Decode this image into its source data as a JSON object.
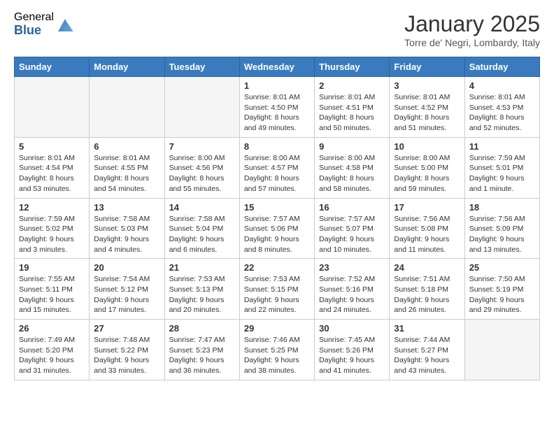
{
  "header": {
    "logo_general": "General",
    "logo_blue": "Blue",
    "month_title": "January 2025",
    "location": "Torre de' Negri, Lombardy, Italy"
  },
  "days_of_week": [
    "Sunday",
    "Monday",
    "Tuesday",
    "Wednesday",
    "Thursday",
    "Friday",
    "Saturday"
  ],
  "weeks": [
    [
      {
        "day": "",
        "sunrise": "",
        "sunset": "",
        "daylight": "",
        "empty": true
      },
      {
        "day": "",
        "sunrise": "",
        "sunset": "",
        "daylight": "",
        "empty": true
      },
      {
        "day": "",
        "sunrise": "",
        "sunset": "",
        "daylight": "",
        "empty": true
      },
      {
        "day": "1",
        "sunrise": "Sunrise: 8:01 AM",
        "sunset": "Sunset: 4:50 PM",
        "daylight": "Daylight: 8 hours and 49 minutes.",
        "empty": false
      },
      {
        "day": "2",
        "sunrise": "Sunrise: 8:01 AM",
        "sunset": "Sunset: 4:51 PM",
        "daylight": "Daylight: 8 hours and 50 minutes.",
        "empty": false
      },
      {
        "day": "3",
        "sunrise": "Sunrise: 8:01 AM",
        "sunset": "Sunset: 4:52 PM",
        "daylight": "Daylight: 8 hours and 51 minutes.",
        "empty": false
      },
      {
        "day": "4",
        "sunrise": "Sunrise: 8:01 AM",
        "sunset": "Sunset: 4:53 PM",
        "daylight": "Daylight: 8 hours and 52 minutes.",
        "empty": false
      }
    ],
    [
      {
        "day": "5",
        "sunrise": "Sunrise: 8:01 AM",
        "sunset": "Sunset: 4:54 PM",
        "daylight": "Daylight: 8 hours and 53 minutes.",
        "empty": false
      },
      {
        "day": "6",
        "sunrise": "Sunrise: 8:01 AM",
        "sunset": "Sunset: 4:55 PM",
        "daylight": "Daylight: 8 hours and 54 minutes.",
        "empty": false
      },
      {
        "day": "7",
        "sunrise": "Sunrise: 8:00 AM",
        "sunset": "Sunset: 4:56 PM",
        "daylight": "Daylight: 8 hours and 55 minutes.",
        "empty": false
      },
      {
        "day": "8",
        "sunrise": "Sunrise: 8:00 AM",
        "sunset": "Sunset: 4:57 PM",
        "daylight": "Daylight: 8 hours and 57 minutes.",
        "empty": false
      },
      {
        "day": "9",
        "sunrise": "Sunrise: 8:00 AM",
        "sunset": "Sunset: 4:58 PM",
        "daylight": "Daylight: 8 hours and 58 minutes.",
        "empty": false
      },
      {
        "day": "10",
        "sunrise": "Sunrise: 8:00 AM",
        "sunset": "Sunset: 5:00 PM",
        "daylight": "Daylight: 8 hours and 59 minutes.",
        "empty": false
      },
      {
        "day": "11",
        "sunrise": "Sunrise: 7:59 AM",
        "sunset": "Sunset: 5:01 PM",
        "daylight": "Daylight: 9 hours and 1 minute.",
        "empty": false
      }
    ],
    [
      {
        "day": "12",
        "sunrise": "Sunrise: 7:59 AM",
        "sunset": "Sunset: 5:02 PM",
        "daylight": "Daylight: 9 hours and 3 minutes.",
        "empty": false
      },
      {
        "day": "13",
        "sunrise": "Sunrise: 7:58 AM",
        "sunset": "Sunset: 5:03 PM",
        "daylight": "Daylight: 9 hours and 4 minutes.",
        "empty": false
      },
      {
        "day": "14",
        "sunrise": "Sunrise: 7:58 AM",
        "sunset": "Sunset: 5:04 PM",
        "daylight": "Daylight: 9 hours and 6 minutes.",
        "empty": false
      },
      {
        "day": "15",
        "sunrise": "Sunrise: 7:57 AM",
        "sunset": "Sunset: 5:06 PM",
        "daylight": "Daylight: 9 hours and 8 minutes.",
        "empty": false
      },
      {
        "day": "16",
        "sunrise": "Sunrise: 7:57 AM",
        "sunset": "Sunset: 5:07 PM",
        "daylight": "Daylight: 9 hours and 10 minutes.",
        "empty": false
      },
      {
        "day": "17",
        "sunrise": "Sunrise: 7:56 AM",
        "sunset": "Sunset: 5:08 PM",
        "daylight": "Daylight: 9 hours and 11 minutes.",
        "empty": false
      },
      {
        "day": "18",
        "sunrise": "Sunrise: 7:56 AM",
        "sunset": "Sunset: 5:09 PM",
        "daylight": "Daylight: 9 hours and 13 minutes.",
        "empty": false
      }
    ],
    [
      {
        "day": "19",
        "sunrise": "Sunrise: 7:55 AM",
        "sunset": "Sunset: 5:11 PM",
        "daylight": "Daylight: 9 hours and 15 minutes.",
        "empty": false
      },
      {
        "day": "20",
        "sunrise": "Sunrise: 7:54 AM",
        "sunset": "Sunset: 5:12 PM",
        "daylight": "Daylight: 9 hours and 17 minutes.",
        "empty": false
      },
      {
        "day": "21",
        "sunrise": "Sunrise: 7:53 AM",
        "sunset": "Sunset: 5:13 PM",
        "daylight": "Daylight: 9 hours and 20 minutes.",
        "empty": false
      },
      {
        "day": "22",
        "sunrise": "Sunrise: 7:53 AM",
        "sunset": "Sunset: 5:15 PM",
        "daylight": "Daylight: 9 hours and 22 minutes.",
        "empty": false
      },
      {
        "day": "23",
        "sunrise": "Sunrise: 7:52 AM",
        "sunset": "Sunset: 5:16 PM",
        "daylight": "Daylight: 9 hours and 24 minutes.",
        "empty": false
      },
      {
        "day": "24",
        "sunrise": "Sunrise: 7:51 AM",
        "sunset": "Sunset: 5:18 PM",
        "daylight": "Daylight: 9 hours and 26 minutes.",
        "empty": false
      },
      {
        "day": "25",
        "sunrise": "Sunrise: 7:50 AM",
        "sunset": "Sunset: 5:19 PM",
        "daylight": "Daylight: 9 hours and 29 minutes.",
        "empty": false
      }
    ],
    [
      {
        "day": "26",
        "sunrise": "Sunrise: 7:49 AM",
        "sunset": "Sunset: 5:20 PM",
        "daylight": "Daylight: 9 hours and 31 minutes.",
        "empty": false
      },
      {
        "day": "27",
        "sunrise": "Sunrise: 7:48 AM",
        "sunset": "Sunset: 5:22 PM",
        "daylight": "Daylight: 9 hours and 33 minutes.",
        "empty": false
      },
      {
        "day": "28",
        "sunrise": "Sunrise: 7:47 AM",
        "sunset": "Sunset: 5:23 PM",
        "daylight": "Daylight: 9 hours and 36 minutes.",
        "empty": false
      },
      {
        "day": "29",
        "sunrise": "Sunrise: 7:46 AM",
        "sunset": "Sunset: 5:25 PM",
        "daylight": "Daylight: 9 hours and 38 minutes.",
        "empty": false
      },
      {
        "day": "30",
        "sunrise": "Sunrise: 7:45 AM",
        "sunset": "Sunset: 5:26 PM",
        "daylight": "Daylight: 9 hours and 41 minutes.",
        "empty": false
      },
      {
        "day": "31",
        "sunrise": "Sunrise: 7:44 AM",
        "sunset": "Sunset: 5:27 PM",
        "daylight": "Daylight: 9 hours and 43 minutes.",
        "empty": false
      },
      {
        "day": "",
        "sunrise": "",
        "sunset": "",
        "daylight": "",
        "empty": true
      }
    ]
  ]
}
